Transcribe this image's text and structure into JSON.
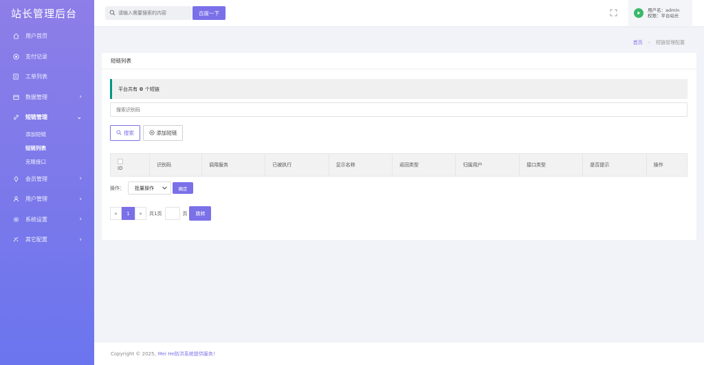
{
  "app": {
    "title": "站长管理后台"
  },
  "sidebar": {
    "items": [
      {
        "label": "用户首页",
        "icon": "home-icon"
      },
      {
        "label": "支付记录",
        "icon": "pay-icon"
      },
      {
        "label": "工单列表",
        "icon": "ticket-icon"
      },
      {
        "label": "数据管理",
        "icon": "data-icon",
        "chevron": "›"
      },
      {
        "label": "短链管理",
        "icon": "link-icon",
        "chevron": "⌄"
      },
      {
        "label": "会员管理",
        "icon": "member-icon",
        "chevron": "›"
      },
      {
        "label": "用户管理",
        "icon": "user-icon",
        "chevron": "›"
      },
      {
        "label": "系统设置",
        "icon": "gear-icon",
        "chevron": "›"
      },
      {
        "label": "其它配置",
        "icon": "config-icon",
        "chevron": "›"
      }
    ],
    "sub_items": [
      {
        "label": "添加短链"
      },
      {
        "label": "短链列表"
      },
      {
        "label": "克隆接口"
      }
    ]
  },
  "topbar": {
    "search_placeholder": "请输入需要搜索的内容",
    "search_button": "百度一下",
    "user_name": "用户名：admin",
    "user_role": "权限：平台站长"
  },
  "breadcrumb": {
    "home": "首页",
    "sep": "›",
    "current": "短链管理配置"
  },
  "card": {
    "title": "短链列表",
    "notice_prefix": "平台共有",
    "notice_count": "0",
    "notice_suffix": "个短链",
    "filter_placeholder": "搜索识别码",
    "search_button": "搜索",
    "add_button": "添加短链",
    "table_headers": [
      "ID",
      "识别码",
      "调用服务",
      "已被执行",
      "显示名称",
      "返回类型",
      "归属用户",
      "接口类型",
      "是否提示",
      "操作"
    ],
    "batch_label": "操作：",
    "batch_select": "批量操作",
    "confirm_button": "确定",
    "pager": {
      "prev": "«",
      "current": "1",
      "next": "»",
      "total": "共1页",
      "unit": "页",
      "jump": "跳转"
    }
  },
  "footer": {
    "copyright": "Copyright © 2025,",
    "link": "Mei He防洪系统提供服务！"
  },
  "colors": {
    "accent": "#7a70e8",
    "notice_bar": "#009688",
    "sidebar_top": "#8d7ee8",
    "sidebar_bottom": "#6b75ee"
  }
}
